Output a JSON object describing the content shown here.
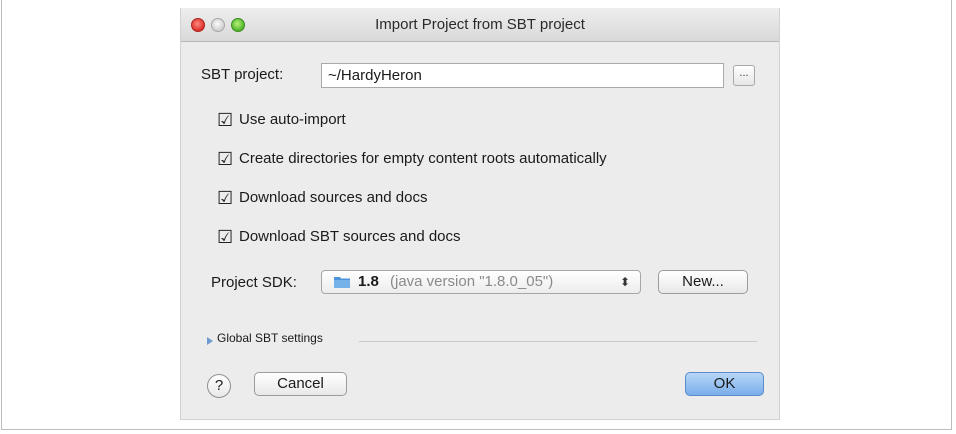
{
  "window": {
    "title": "Import Project from SBT project"
  },
  "form": {
    "sbt_project_label": "SBT project:",
    "sbt_project_value": "~/HardyHeron",
    "browse_label": "...",
    "checkboxes": [
      {
        "label": "Use auto-import",
        "checked": true
      },
      {
        "label": "Create directories for empty content roots automatically",
        "checked": true
      },
      {
        "label": "Download sources and docs",
        "checked": true
      },
      {
        "label": "Download SBT sources and docs",
        "checked": true
      }
    ],
    "project_sdk_label": "Project SDK:",
    "sdk_version": "1.8",
    "sdk_description": "(java version \"1.8.0_05\")",
    "new_button_label": "New...",
    "global_settings_label": "Global SBT settings"
  },
  "footer": {
    "help_label": "?",
    "cancel_label": "Cancel",
    "ok_label": "OK"
  },
  "colors": {
    "window_bg": "#ececec",
    "ok_button": "#7aaeea",
    "disclosure": "#6e9bd0"
  }
}
